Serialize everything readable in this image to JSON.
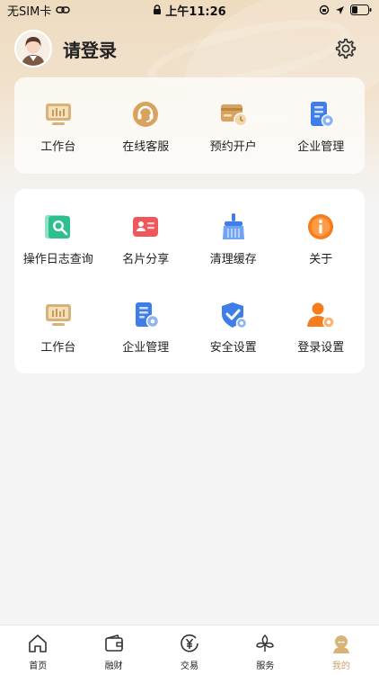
{
  "status_bar": {
    "carrier": "无SIM卡",
    "time": "上午11:26"
  },
  "profile": {
    "login_text": "请登录"
  },
  "quick_card": {
    "items": [
      {
        "label": "工作台",
        "icon": "monitor-icon"
      },
      {
        "label": "在线客服",
        "icon": "customer-service-icon"
      },
      {
        "label": "预约开户",
        "icon": "card-clock-icon"
      },
      {
        "label": "企业管理",
        "icon": "building-gear-icon"
      }
    ]
  },
  "tools_card": {
    "items": [
      {
        "label": "操作日志查询",
        "icon": "log-search-icon"
      },
      {
        "label": "名片分享",
        "icon": "business-card-icon"
      },
      {
        "label": "清理缓存",
        "icon": "broom-icon"
      },
      {
        "label": "关于",
        "icon": "info-icon"
      },
      {
        "label": "工作台",
        "icon": "monitor-icon"
      },
      {
        "label": "企业管理",
        "icon": "building-gear-icon"
      },
      {
        "label": "安全设置",
        "icon": "shield-check-icon"
      },
      {
        "label": "登录设置",
        "icon": "user-gear-icon"
      }
    ]
  },
  "tabbar": {
    "tabs": [
      {
        "label": "首页",
        "icon": "home-icon"
      },
      {
        "label": "融财",
        "icon": "wallet-icon"
      },
      {
        "label": "交易",
        "icon": "yen-icon"
      },
      {
        "label": "服务",
        "icon": "service-icon"
      },
      {
        "label": "我的",
        "icon": "user-icon",
        "active": true
      }
    ]
  },
  "colors": {
    "accent": "#c8a26a",
    "gold": "#d9b277",
    "blue": "#3f7ee8",
    "green": "#2ebf8e",
    "red": "#f0575b",
    "orange": "#f57d1c"
  }
}
